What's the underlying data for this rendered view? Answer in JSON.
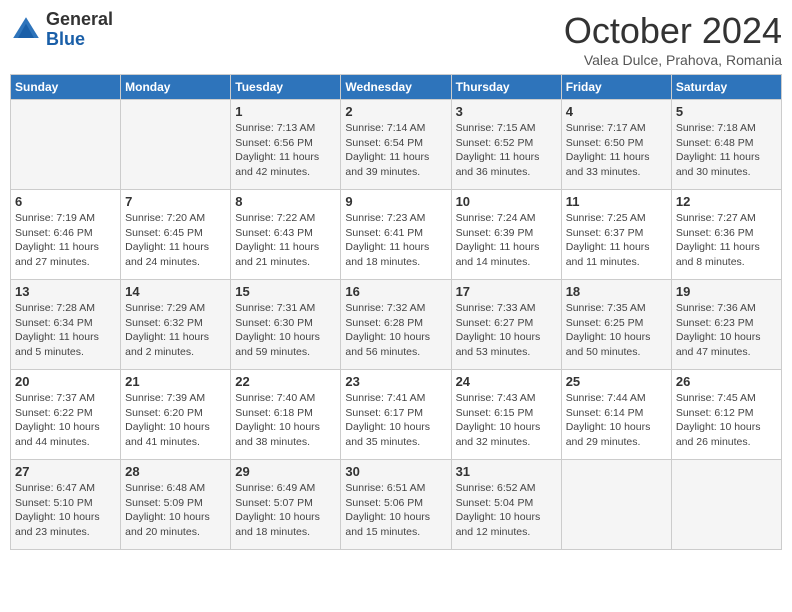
{
  "header": {
    "logo_general": "General",
    "logo_blue": "Blue",
    "title": "October 2024",
    "subtitle": "Valea Dulce, Prahova, Romania"
  },
  "weekdays": [
    "Sunday",
    "Monday",
    "Tuesday",
    "Wednesday",
    "Thursday",
    "Friday",
    "Saturday"
  ],
  "weeks": [
    [
      {
        "day": "",
        "info": ""
      },
      {
        "day": "",
        "info": ""
      },
      {
        "day": "1",
        "info": "Sunrise: 7:13 AM\nSunset: 6:56 PM\nDaylight: 11 hours and 42 minutes."
      },
      {
        "day": "2",
        "info": "Sunrise: 7:14 AM\nSunset: 6:54 PM\nDaylight: 11 hours and 39 minutes."
      },
      {
        "day": "3",
        "info": "Sunrise: 7:15 AM\nSunset: 6:52 PM\nDaylight: 11 hours and 36 minutes."
      },
      {
        "day": "4",
        "info": "Sunrise: 7:17 AM\nSunset: 6:50 PM\nDaylight: 11 hours and 33 minutes."
      },
      {
        "day": "5",
        "info": "Sunrise: 7:18 AM\nSunset: 6:48 PM\nDaylight: 11 hours and 30 minutes."
      }
    ],
    [
      {
        "day": "6",
        "info": "Sunrise: 7:19 AM\nSunset: 6:46 PM\nDaylight: 11 hours and 27 minutes."
      },
      {
        "day": "7",
        "info": "Sunrise: 7:20 AM\nSunset: 6:45 PM\nDaylight: 11 hours and 24 minutes."
      },
      {
        "day": "8",
        "info": "Sunrise: 7:22 AM\nSunset: 6:43 PM\nDaylight: 11 hours and 21 minutes."
      },
      {
        "day": "9",
        "info": "Sunrise: 7:23 AM\nSunset: 6:41 PM\nDaylight: 11 hours and 18 minutes."
      },
      {
        "day": "10",
        "info": "Sunrise: 7:24 AM\nSunset: 6:39 PM\nDaylight: 11 hours and 14 minutes."
      },
      {
        "day": "11",
        "info": "Sunrise: 7:25 AM\nSunset: 6:37 PM\nDaylight: 11 hours and 11 minutes."
      },
      {
        "day": "12",
        "info": "Sunrise: 7:27 AM\nSunset: 6:36 PM\nDaylight: 11 hours and 8 minutes."
      }
    ],
    [
      {
        "day": "13",
        "info": "Sunrise: 7:28 AM\nSunset: 6:34 PM\nDaylight: 11 hours and 5 minutes."
      },
      {
        "day": "14",
        "info": "Sunrise: 7:29 AM\nSunset: 6:32 PM\nDaylight: 11 hours and 2 minutes."
      },
      {
        "day": "15",
        "info": "Sunrise: 7:31 AM\nSunset: 6:30 PM\nDaylight: 10 hours and 59 minutes."
      },
      {
        "day": "16",
        "info": "Sunrise: 7:32 AM\nSunset: 6:28 PM\nDaylight: 10 hours and 56 minutes."
      },
      {
        "day": "17",
        "info": "Sunrise: 7:33 AM\nSunset: 6:27 PM\nDaylight: 10 hours and 53 minutes."
      },
      {
        "day": "18",
        "info": "Sunrise: 7:35 AM\nSunset: 6:25 PM\nDaylight: 10 hours and 50 minutes."
      },
      {
        "day": "19",
        "info": "Sunrise: 7:36 AM\nSunset: 6:23 PM\nDaylight: 10 hours and 47 minutes."
      }
    ],
    [
      {
        "day": "20",
        "info": "Sunrise: 7:37 AM\nSunset: 6:22 PM\nDaylight: 10 hours and 44 minutes."
      },
      {
        "day": "21",
        "info": "Sunrise: 7:39 AM\nSunset: 6:20 PM\nDaylight: 10 hours and 41 minutes."
      },
      {
        "day": "22",
        "info": "Sunrise: 7:40 AM\nSunset: 6:18 PM\nDaylight: 10 hours and 38 minutes."
      },
      {
        "day": "23",
        "info": "Sunrise: 7:41 AM\nSunset: 6:17 PM\nDaylight: 10 hours and 35 minutes."
      },
      {
        "day": "24",
        "info": "Sunrise: 7:43 AM\nSunset: 6:15 PM\nDaylight: 10 hours and 32 minutes."
      },
      {
        "day": "25",
        "info": "Sunrise: 7:44 AM\nSunset: 6:14 PM\nDaylight: 10 hours and 29 minutes."
      },
      {
        "day": "26",
        "info": "Sunrise: 7:45 AM\nSunset: 6:12 PM\nDaylight: 10 hours and 26 minutes."
      }
    ],
    [
      {
        "day": "27",
        "info": "Sunrise: 6:47 AM\nSunset: 5:10 PM\nDaylight: 10 hours and 23 minutes."
      },
      {
        "day": "28",
        "info": "Sunrise: 6:48 AM\nSunset: 5:09 PM\nDaylight: 10 hours and 20 minutes."
      },
      {
        "day": "29",
        "info": "Sunrise: 6:49 AM\nSunset: 5:07 PM\nDaylight: 10 hours and 18 minutes."
      },
      {
        "day": "30",
        "info": "Sunrise: 6:51 AM\nSunset: 5:06 PM\nDaylight: 10 hours and 15 minutes."
      },
      {
        "day": "31",
        "info": "Sunrise: 6:52 AM\nSunset: 5:04 PM\nDaylight: 10 hours and 12 minutes."
      },
      {
        "day": "",
        "info": ""
      },
      {
        "day": "",
        "info": ""
      }
    ]
  ]
}
